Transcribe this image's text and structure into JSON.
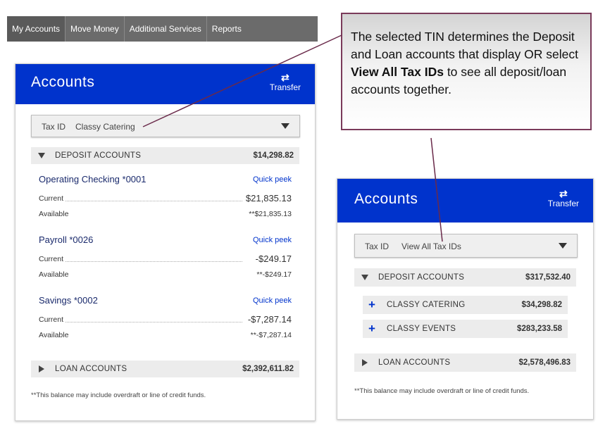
{
  "nav": {
    "items": [
      "My Accounts",
      "Move Money",
      "Additional Services",
      "Reports"
    ]
  },
  "left_panel": {
    "title": "Accounts",
    "transfer_label": "Transfer",
    "taxid": {
      "label": "Tax ID",
      "value": "Classy Catering"
    },
    "deposit": {
      "label": "DEPOSIT ACCOUNTS",
      "amount": "$14,298.82"
    },
    "accounts": [
      {
        "name": "Operating Checking  *0001",
        "peek": "Quick peek",
        "current_label": "Current",
        "current": "$21,835.13",
        "available_label": "Available",
        "available": "**$21,835.13"
      },
      {
        "name": "Payroll  *0026",
        "peek": "Quick peek",
        "current_label": "Current",
        "current": "-$249.17",
        "available_label": "Available",
        "available": "**-$249.17"
      },
      {
        "name": "Savings  *0002",
        "peek": "Quick peek",
        "current_label": "Current",
        "current": "-$7,287.14",
        "available_label": "Available",
        "available": "**-$7,287.14"
      }
    ],
    "loan": {
      "label": "LOAN ACCOUNTS",
      "amount": "$2,392,611.82"
    },
    "note": "**This balance may include overdraft or line of credit funds."
  },
  "right_panel": {
    "title": "Accounts",
    "transfer_label": "Transfer",
    "taxid": {
      "label": "Tax ID",
      "value": "View All Tax IDs"
    },
    "deposit": {
      "label": "DEPOSIT ACCOUNTS",
      "amount": "$317,532.40"
    },
    "groups": [
      {
        "name": "CLASSY CATERING",
        "amount": "$34,298.82"
      },
      {
        "name": "CLASSY EVENTS",
        "amount": "$283,233.58"
      }
    ],
    "loan": {
      "label": "LOAN ACCOUNTS",
      "amount": "$2,578,496.83"
    },
    "note": "**This balance may include overdraft or line of credit funds."
  },
  "callout": {
    "text_before": "The selected TIN determines the Deposit and Loan accounts that display OR select ",
    "text_bold": "View All Tax IDs",
    "text_after": " to see all deposit/loan accounts together."
  },
  "colors": {
    "header_blue": "#0033cc",
    "nav_gray": "#6b6b6b",
    "callout_border": "#7a3a5a"
  },
  "icons": {
    "transfer": "transfer-arrows-icon",
    "dropdown": "caret-down-icon",
    "expand": "plus-icon"
  }
}
